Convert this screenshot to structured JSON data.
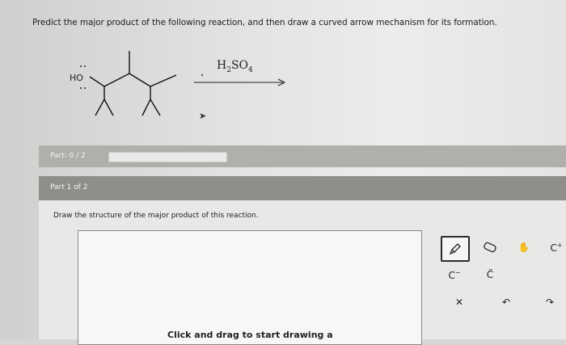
{
  "question": {
    "prompt": "Predict the major product of the following reaction, and then draw a curved arrow mechanism for its formation.",
    "reactant_label": "HO",
    "reagent": "H2SO4"
  },
  "progress": {
    "label": "Part: 0 / 2",
    "fraction": 0
  },
  "part": {
    "title": "Part 1 of 2",
    "instruction": "Draw the structure of the major product of this reaction."
  },
  "canvas": {
    "hint": "Click and drag to start drawing a"
  },
  "toolbar": {
    "tools": [
      "pencil-icon",
      "eraser-icon",
      "hand-icon",
      "C+",
      "C−",
      "C̈",
      "close-icon",
      "undo-icon",
      "redo-icon"
    ],
    "active_tool": "pencil-icon"
  }
}
